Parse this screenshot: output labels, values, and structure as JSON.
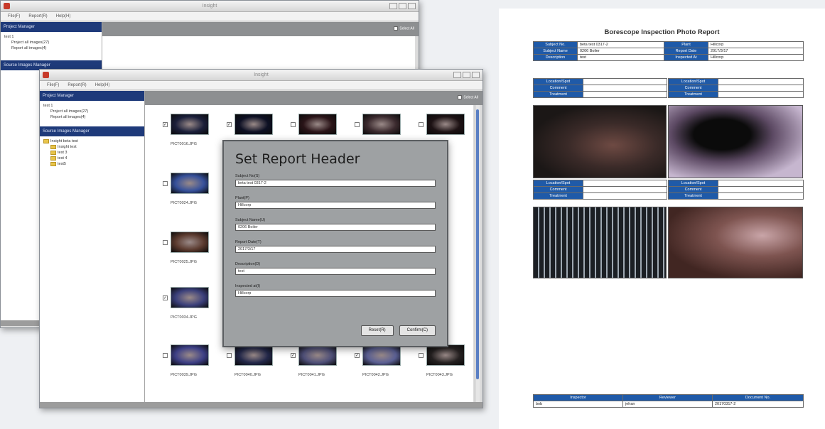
{
  "back_window": {
    "menu": [
      "File(F)",
      "Report(R)",
      "Help(H)"
    ],
    "project_manager_title": "Project Manager",
    "project_tree": [
      "test 1",
      "Project all images(27)",
      "Report all images(4)"
    ],
    "source_manager_title": "Source Images Manager",
    "select_all": "Select All"
  },
  "front_window": {
    "title": "Insight",
    "menu": [
      "File(F)",
      "Report(R)",
      "Help(H)"
    ],
    "project_manager_title": "Project Manager",
    "project_tree": [
      "test 1",
      "Project all images(27)",
      "Report all images(4)"
    ],
    "source_manager_title": "Source Images Manager",
    "source_tree": [
      "Insight beta test",
      "Insight test",
      "test 3",
      "test 4",
      "test5"
    ],
    "select_all": "Select All",
    "thumbnails": [
      {
        "caption": "PICT0016.JPG",
        "checked": true,
        "color": "#1a1f3a"
      },
      {
        "caption": "",
        "checked": true,
        "color": "#0d1024"
      },
      {
        "caption": "",
        "checked": false,
        "color": "#2a1418"
      },
      {
        "caption": "",
        "checked": false,
        "color": "#3b2a2e"
      },
      {
        "caption": "",
        "checked": false,
        "color": "#1d1214"
      },
      {
        "caption": "PICT0024.JPG",
        "checked": false,
        "color": "#35509a"
      },
      {
        "caption": "PICT0025.JPG",
        "checked": false,
        "color": "#5a3a2e"
      },
      {
        "caption": "PICT0034.JPG",
        "checked": true,
        "color": "#3a3f7a"
      },
      {
        "caption": "PICT0039.JPG",
        "checked": false,
        "color": "#3c3f85"
      },
      {
        "caption": "PICT0040.JPG",
        "checked": false,
        "color": "#23284a"
      },
      {
        "caption": "PICT0041.JPG",
        "checked": true,
        "color": "#4e4f78"
      },
      {
        "caption": "PICT0042.JPG",
        "checked": true,
        "color": "#5a5f93"
      },
      {
        "caption": "PICT0043.JPG",
        "checked": false,
        "color": "#242020"
      }
    ]
  },
  "dialog": {
    "title": "Set Report Header",
    "fields": [
      {
        "label": "Subject No(S)",
        "value": "beta test 0317-2"
      },
      {
        "label": "Plant(P)",
        "value": "Hillcorp"
      },
      {
        "label": "Subject Name(U)",
        "value": "0206 Boiler"
      },
      {
        "label": "Report Date(T)",
        "value": "2017/3/17"
      },
      {
        "label": "Description(D)",
        "value": "test"
      },
      {
        "label": "Inspected at(I)",
        "value": "Hillcorp"
      }
    ],
    "reset_label": "Reset(R)",
    "confirm_label": "Confirm(C)"
  },
  "report": {
    "title": "Borescope Inspection Photo Report",
    "header": [
      {
        "k1": "Subject No.",
        "v1": "beta test 0317-2",
        "k2": "Plant",
        "v2": "Hillcorp"
      },
      {
        "k1": "Subject Name",
        "v1": "0206 Boiler",
        "k2": "Report Date",
        "v2": "2017/3/17"
      },
      {
        "k1": "Description",
        "v1": "test",
        "k2": "Inspected At",
        "v2": "Hillcorp"
      }
    ],
    "photo_labels": [
      "Location/Spot",
      "Comment",
      "Treatment"
    ],
    "footer_headers": [
      "Inspector",
      "Reviewer",
      "Document No."
    ],
    "footer_values": [
      "bob",
      "jehan",
      "20170317-2"
    ]
  }
}
